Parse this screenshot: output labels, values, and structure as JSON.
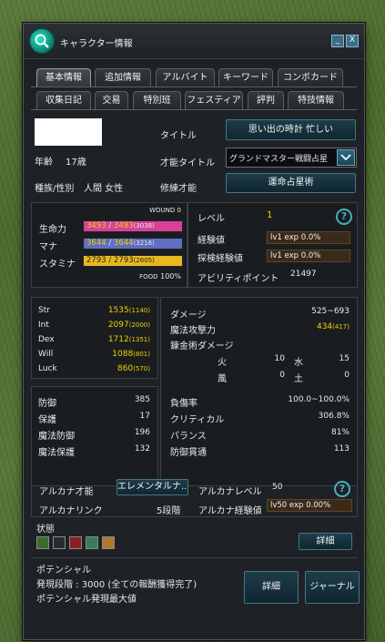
{
  "window": {
    "title": "キャラクター情報",
    "minimize": "_",
    "close": "X"
  },
  "tabs_row1": [
    "基本情報",
    "追加情報",
    "アルバイト",
    "キーワード",
    "コンボカード"
  ],
  "tabs_row2": [
    "収集日記",
    "交易",
    "特別班",
    "フェスティア",
    "評判",
    "特技情報"
  ],
  "profile": {
    "age_label": "年齢",
    "age_value": "17歳",
    "race_label": "種族/性別",
    "race_value": "人間 女性",
    "title_label": "タイトル",
    "title_value": "思い出の時計 忙しい",
    "talent_title_label": "才能タイトル",
    "talent_title_value": "グランドマスター戦闘占星",
    "training_label": "修練才能",
    "training_value": "運命占星術"
  },
  "vitals": {
    "wound_label": "WOUND",
    "wound_value": "0",
    "hp_label": "生命力",
    "hp_value": "3493",
    "hp_max": "3493",
    "hp_base": "(3038)",
    "mp_label": "マナ",
    "mp_value": "3644",
    "mp_max": "3644",
    "mp_base": "(3216)",
    "sp_label": "スタミナ",
    "sp_value": "2793",
    "sp_max": "2793",
    "sp_base": "(2605)",
    "food_label": "FOOD",
    "food_value": "100%",
    "colors": {
      "hp": "#d8409a",
      "mp": "#5f6ec0",
      "sp": "#e8b820"
    }
  },
  "level": {
    "level_label": "レベル",
    "level_value": "1",
    "exp_label": "経験値",
    "exp_value": "lv1 exp 0.0%",
    "explore_label": "探検経験値",
    "explore_value": "lv1 exp 0.0%",
    "ap_label": "アビリティポイント",
    "ap_value": "21497"
  },
  "stats": [
    {
      "name": "Str",
      "value": "1535",
      "base": "(1140)"
    },
    {
      "name": "Int",
      "value": "2097",
      "base": "(2000)"
    },
    {
      "name": "Dex",
      "value": "1712",
      "base": "(1351)"
    },
    {
      "name": "Will",
      "value": "1088",
      "base": "(801)"
    },
    {
      "name": "Luck",
      "value": "860",
      "base": "(570)"
    }
  ],
  "defense": [
    {
      "name": "防御",
      "value": "385"
    },
    {
      "name": "保護",
      "value": "17"
    },
    {
      "name": "魔法防御",
      "value": "196"
    },
    {
      "name": "魔法保護",
      "value": "132"
    }
  ],
  "attack": {
    "damage_label": "ダメージ",
    "damage_value": "525~693",
    "magic_label": "魔法攻撃力",
    "magic_value": "434",
    "magic_base": "(417)",
    "alchemy_label": "錬金術ダメージ",
    "fire_label": "火",
    "fire_value": "10",
    "water_label": "水",
    "water_value": "15",
    "wind_label": "風",
    "wind_value": "0",
    "earth_label": "土",
    "earth_value": "0"
  },
  "combat": [
    {
      "name": "負傷率",
      "value": "100.0~100.0%"
    },
    {
      "name": "クリティカル",
      "value": "306.8%"
    },
    {
      "name": "バランス",
      "value": "81%"
    },
    {
      "name": "防御貫通",
      "value": "113"
    }
  ],
  "arcana": {
    "talent_label": "アルカナ才能",
    "talent_value": "エレメンタルナ...",
    "level_label": "アルカナレベル",
    "level_value": "50",
    "link_label": "アルカナリンク",
    "link_value": "5段階",
    "exp_label": "アルカナ経験値",
    "exp_value": "lv50 exp 0.00%"
  },
  "status": {
    "label": "状態",
    "detail_button": "詳細"
  },
  "potential": {
    "title": "ポテンシャル",
    "line1": "発現段階 : 3000 (全ての報酬獲得完了)",
    "line2": "ポテンシャル発現最大値",
    "detail_button": "詳細",
    "journal_button": "ジャーナル"
  }
}
